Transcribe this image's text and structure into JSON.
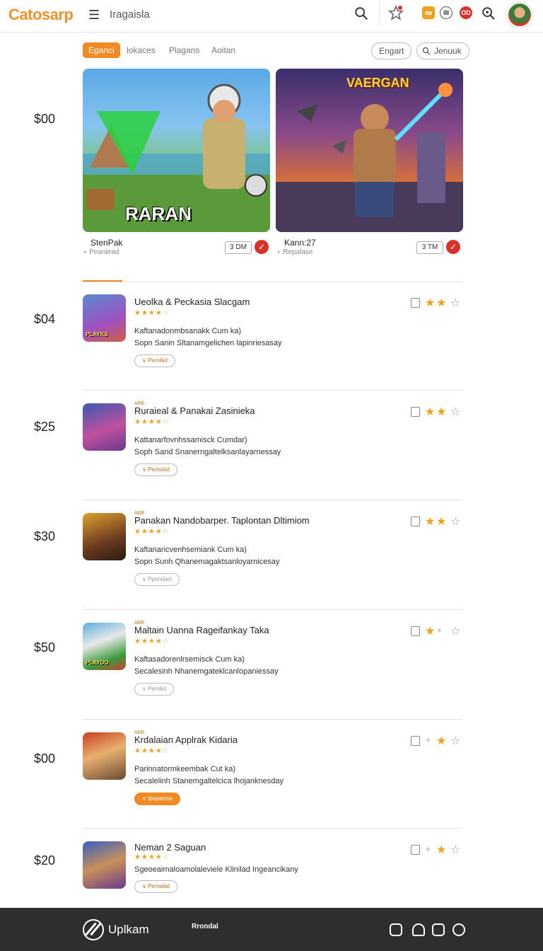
{
  "app": {
    "logo": "Catosarp",
    "search_text": "Iragaisla",
    "badges": [
      "ꝏ",
      "Ⅲ",
      "OD"
    ]
  },
  "tabs": [
    {
      "label": "Eganci",
      "active": true
    },
    {
      "label": "lokaces",
      "active": false
    },
    {
      "label": "Plagans",
      "active": false
    },
    {
      "label": "Aoitan",
      "active": false
    }
  ],
  "pills": {
    "engart": "Engart",
    "search": "Jenuuk"
  },
  "prices": [
    "$00",
    "$04",
    "$25",
    "$30",
    "$50",
    "$00",
    "$20"
  ],
  "featured": [
    {
      "art_title": "RARAN",
      "name": "StenPak",
      "sub": "Peanlead",
      "size": "3 DM",
      "check": "✓"
    },
    {
      "art_title": "VAERGAN",
      "name": "Kann:27",
      "sub": "Repalase",
      "size": "3 TM",
      "check": "✓"
    }
  ],
  "items": [
    {
      "tag": "",
      "title": "Ueolka & Peckasia Slacgam",
      "stars": "★★★★",
      "stars_off": "☆",
      "desc1": "Kaftanadonmbsanakk Cum ka)",
      "desc2": "Sopn Sanin Sltanamgelichen lapinriesasay",
      "button": "∨ Pemilkit",
      "filled": false,
      "thumb_label": "PLAYKS",
      "rating": [
        true,
        true,
        true
      ]
    },
    {
      "tag": "ABB",
      "title": "Ruraieal & Panakai Zasinieka",
      "stars": "★★★★",
      "stars_off": "☆",
      "desc1": "Kattanarfovnhssamisck Cumdar)",
      "desc2": "Soph Sand Snanerngaltelksanlayarnessay",
      "button": "∨ Pemulait",
      "filled": false,
      "thumb_label": "",
      "rating": [
        true,
        true,
        false
      ]
    },
    {
      "tag": "ABB",
      "title": "Panakan Nandobarper. Taplontan Dltimiom",
      "stars": "★★★★",
      "stars_off": "☆",
      "desc1": "Kaftanaricvenhsemiank Cum ka)",
      "desc2": "Sopn Sunh Qhanemagaktsanloyarnicesay",
      "button": "∨ Ppendact",
      "filled": false,
      "thumb_label": "",
      "rating": [
        true,
        true,
        false
      ]
    },
    {
      "tag": "ABB",
      "title": "Maltain Uanna Rageifankay Taka",
      "stars": "★★★★",
      "stars_off": "☆",
      "desc1": "Kaftasadorenlrsemisck Cum ka)",
      "desc2": "Secalesinh Nhanemgateklcanlopaniessay",
      "button": "∨ Pemlkit",
      "filled": false,
      "thumb_label": "PLAYDO",
      "rating": [
        true,
        false,
        false
      ]
    },
    {
      "tag": "ABB",
      "title": "Krdalaian Applrak Kidaria",
      "stars": "★★★★",
      "stars_off": "☆",
      "desc1": "Parinnatormkeembak Cut ka)",
      "desc2": "Secalelinh Stanemgaltelcica lhojanknesday",
      "button": "∨ Ipepainsa",
      "filled": true,
      "thumb_label": "",
      "rating": [
        false,
        true,
        false
      ]
    },
    {
      "tag": "",
      "title": "Neman 2 Saguan",
      "stars": "★★★★",
      "stars_off": "☆",
      "desc1": "Sgeoeaimaloamolaleviele Klinilad Ingeancikany",
      "desc2": "",
      "button": "∨ Pemaliat",
      "filled": false,
      "thumb_label": "",
      "rating": [
        false,
        true,
        false
      ]
    }
  ],
  "bottom": {
    "title": "Uplkam",
    "sub": "Rrondal"
  },
  "colors": {
    "accent": "#f08a24",
    "star": "#f0a020",
    "danger": "#d8322c",
    "footer_bg": "#2e2e2e"
  }
}
